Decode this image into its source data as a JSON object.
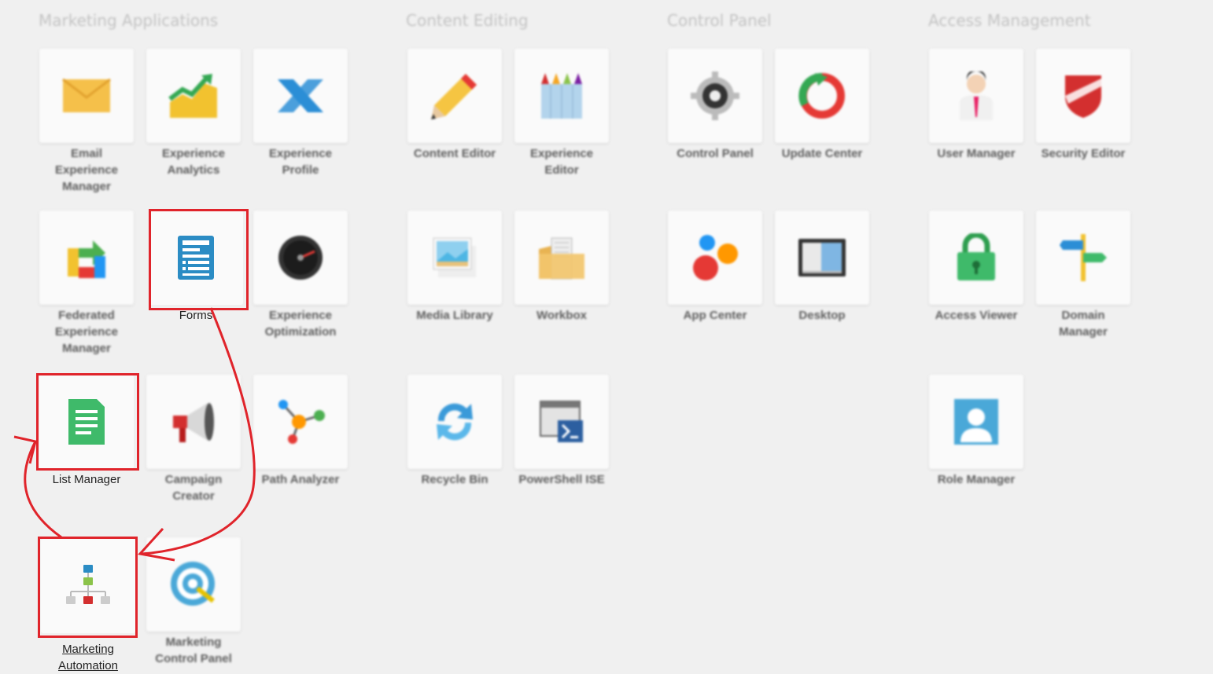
{
  "sections": {
    "marketing": "Marketing Applications",
    "content": "Content Editing",
    "control": "Control Panel",
    "access": "Access Management"
  },
  "tiles": {
    "email_experience_manager": "Email\nExperience\nManager",
    "experience_analytics": "Experience\nAnalytics",
    "experience_profile": "Experience\nProfile",
    "federated_experience_manager": "Federated\nExperience\nManager",
    "forms": "Forms",
    "experience_optimization": "Experience\nOptimization",
    "list_manager": "List Manager",
    "campaign_creator": "Campaign\nCreator",
    "path_analyzer": "Path Analyzer",
    "marketing_automation": "Marketing\nAutomation",
    "marketing_control_panel": "Marketing\nControl Panel",
    "content_editor": "Content Editor",
    "experience_editor": "Experience\nEditor",
    "media_library": "Media Library",
    "workbox": "Workbox",
    "recycle_bin": "Recycle Bin",
    "powershell_ise": "PowerShell ISE",
    "control_panel": "Control Panel",
    "update_center": "Update Center",
    "app_center": "App Center",
    "desktop": "Desktop",
    "user_manager": "User Manager",
    "security_editor": "Security Editor",
    "access_viewer": "Access Viewer",
    "domain_manager": "Domain\nManager",
    "role_manager": "Role Manager"
  },
  "annotations": {
    "highlight_color": "#e0242b",
    "highlighted_tiles": [
      "forms",
      "list_manager",
      "marketing_automation"
    ]
  }
}
